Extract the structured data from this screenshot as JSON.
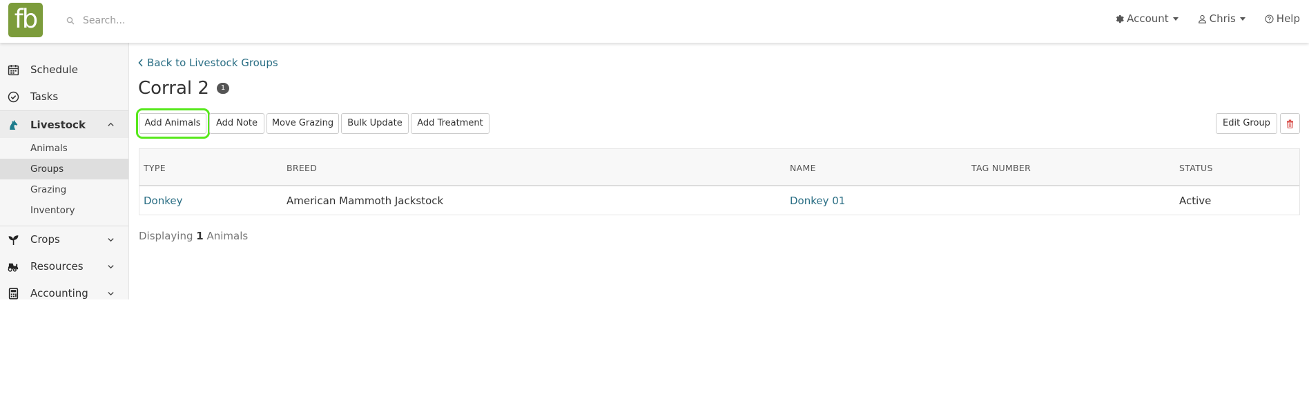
{
  "topbar": {
    "logo_text": "fb",
    "search_placeholder": "Search...",
    "account_label": "Account",
    "user_label": "Chris",
    "help_label": "Help"
  },
  "sidebar": {
    "items": [
      {
        "label": "Schedule",
        "icon": "calendar-icon"
      },
      {
        "label": "Tasks",
        "icon": "check-circle-icon"
      },
      {
        "label": "Livestock",
        "icon": "horse-icon",
        "active": true
      },
      {
        "label": "Crops",
        "icon": "sprout-icon"
      },
      {
        "label": "Resources",
        "icon": "tractor-icon"
      },
      {
        "label": "Accounting",
        "icon": "calculator-icon"
      }
    ],
    "livestock_sub": [
      {
        "label": "Animals"
      },
      {
        "label": "Groups",
        "active": true
      },
      {
        "label": "Grazing"
      },
      {
        "label": "Inventory"
      }
    ]
  },
  "main": {
    "back_link": "Back to Livestock Groups",
    "title": "Corral 2",
    "count_badge": "1",
    "actions": [
      "Add Animals",
      "Add Note",
      "Move Grazing",
      "Bulk Update",
      "Add Treatment"
    ],
    "edit_group": "Edit Group",
    "table": {
      "headers": [
        "TYPE",
        "BREED",
        "NAME",
        "TAG NUMBER",
        "STATUS"
      ],
      "rows": [
        {
          "type": "Donkey",
          "breed": "American Mammoth Jackstock",
          "name": "Donkey 01",
          "tag": "",
          "status": "Active"
        }
      ]
    },
    "footer": {
      "prefix": "Displaying",
      "count": "1",
      "suffix": "Animals"
    }
  },
  "colors": {
    "brand": "#7c9c3b",
    "link": "#2a6e84",
    "highlight": "#57e81c",
    "danger": "#d9534f"
  }
}
